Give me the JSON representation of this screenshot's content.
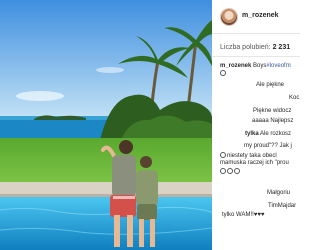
{
  "post": {
    "username": "m_rozenek",
    "likes_label": "Liczba polubień:",
    "likes_count": "2 231",
    "caption_username": "m_rozenek",
    "caption_text": " Boys",
    "caption_hashtag": "#loveofm"
  },
  "comments": [
    {
      "user": "",
      "text": "Ale piękne"
    },
    {
      "user": "",
      "text": "Koc"
    },
    {
      "user": "",
      "text": "Piękne widocz"
    },
    {
      "user": "",
      "text": "aaaaa Najlepsz"
    },
    {
      "user": "tylka",
      "text": " Ale rozkosz"
    },
    {
      "user": "",
      "text": "my proud\"?? Jak j"
    },
    {
      "user": "",
      "text": "niestety taka obecl"
    },
    {
      "user": "",
      "text": "mamuska raczej ich \"prou"
    },
    {
      "user": "",
      "text": "Małgoriu"
    },
    {
      "user": "",
      "text": "TimMajdar"
    },
    {
      "user": "",
      "text": "tylko WAM!!"
    }
  ],
  "colors": {
    "sky_top": "#4f9be6",
    "sky_bottom": "#bfe1f7",
    "sea": "#1d8fc9",
    "grass": "#6fb53b",
    "pool": "#1aa5e0"
  }
}
